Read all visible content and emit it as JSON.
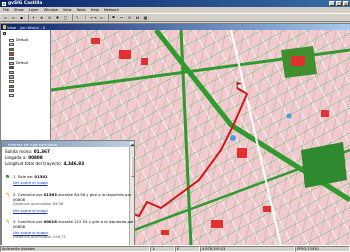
{
  "app": {
    "title": "gvSIG Castilla"
  },
  "window_buttons": [
    "_",
    "□",
    "×"
  ],
  "menu": [
    "File",
    "Show",
    "Layer",
    "Window",
    "View",
    "Table",
    "Help",
    "Network"
  ],
  "doc_window": {
    "title": "View : (sin título) - 0"
  },
  "toc": {
    "layer_name": "",
    "legend": [
      {
        "label": "Default",
        "color": "#ffffff"
      },
      {
        "label": "",
        "color": "#f3c9cf"
      },
      {
        "label": "",
        "color": "#3f8f2f"
      },
      {
        "label": "",
        "color": "#e03030"
      },
      {
        "label": "",
        "color": "#4fb84f"
      },
      {
        "label": "Default",
        "color": "#b8c4b8"
      },
      {
        "label": "",
        "color": "#9c2424"
      },
      {
        "label": "",
        "color": "#7ac67a"
      },
      {
        "label": "",
        "color": "#e89090"
      },
      {
        "label": "",
        "color": "#c8e8c8"
      },
      {
        "label": "",
        "color": "#30a030"
      },
      {
        "label": "",
        "color": "#9aa0b8"
      },
      {
        "label": "",
        "color": "#dddddd"
      }
    ]
  },
  "route_panel": {
    "title": "Informe de ruta calculada",
    "close": "×",
    "summary": [
      {
        "label": "Salida mono:",
        "value": "01,367"
      },
      {
        "label": "Llegada a:",
        "value": "00808"
      },
      {
        "label": "Longitud total del trayecto:",
        "value": "4,346.83"
      }
    ],
    "steps": [
      {
        "icon": "flag-icon",
        "text_a": "1. Sale de:",
        "text_b": "01301",
        "text_c": "",
        "link": "Ver sobre el mapa",
        "accum": ""
      },
      {
        "icon": "turn-icon",
        "text_a": "2. Continúe por",
        "text_b": "01363",
        "text_c": "durante 84.58 y gire a la izquierda  por 00808",
        "link": "Ver sobre el mapa",
        "accum": "Distancia acumulada: 84.58"
      },
      {
        "icon": "turn-icon",
        "text_a": "3. Continúe por",
        "text_b": "00016",
        "text_c": "durante 212.54 y gire a la izquierda  por 00808",
        "link": "Ver sobre el mapa",
        "accum": "Distancia acumulada: 296.72"
      }
    ]
  },
  "status": {
    "left": "Aplicación Asdotes",
    "cells": [
      "1:",
      "E",
      "4,878,393.03",
      "EPSG:23030"
    ]
  }
}
